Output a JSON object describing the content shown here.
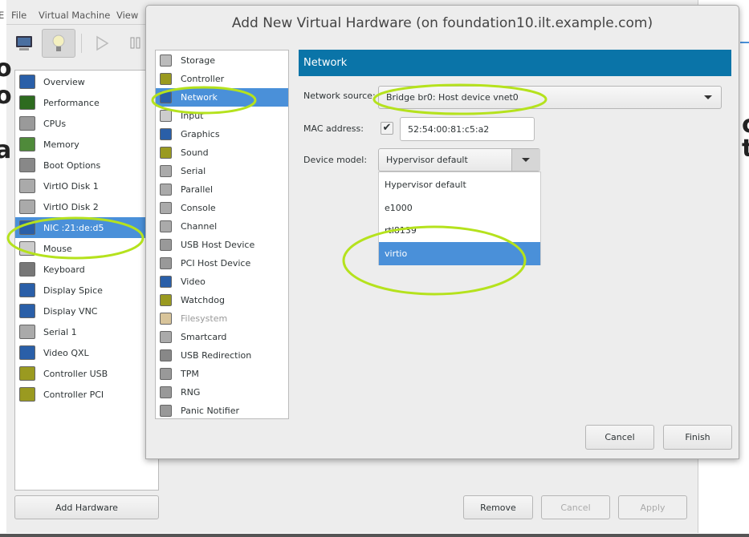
{
  "main_window": {
    "menu": [
      "E",
      "File",
      "Virtual Machine",
      "View"
    ],
    "toolbar": {
      "console": "monitor-icon",
      "details": "lightbulb-icon",
      "run": "play-icon",
      "pause": "pause-icon"
    },
    "hardware_list": [
      {
        "label": "Overview",
        "icon": "monitor-icon",
        "color": "#2a5fa8"
      },
      {
        "label": "Performance",
        "icon": "chart-icon",
        "color": "#2d6b1f"
      },
      {
        "label": "CPUs",
        "icon": "chip-icon",
        "color": "#9a9a9a"
      },
      {
        "label": "Memory",
        "icon": "memory-icon",
        "color": "#4f8a3a"
      },
      {
        "label": "Boot Options",
        "icon": "gears-icon",
        "color": "#888888"
      },
      {
        "label": "VirtIO Disk 1",
        "icon": "disk-icon",
        "color": "#aaaaaa"
      },
      {
        "label": "VirtIO Disk 2",
        "icon": "disk-icon",
        "color": "#aaaaaa"
      },
      {
        "label": "NIC :21:de:d5",
        "icon": "network-icon",
        "color": "#2a5fa8",
        "selected": true
      },
      {
        "label": "Mouse",
        "icon": "mouse-icon",
        "color": "#cccccc"
      },
      {
        "label": "Keyboard",
        "icon": "keyboard-icon",
        "color": "#777777"
      },
      {
        "label": "Display Spice",
        "icon": "monitor-icon",
        "color": "#2a5fa8"
      },
      {
        "label": "Display VNC",
        "icon": "monitor-icon",
        "color": "#2a5fa8"
      },
      {
        "label": "Serial 1",
        "icon": "serial-icon",
        "color": "#aaaaaa"
      },
      {
        "label": "Video QXL",
        "icon": "monitor-icon",
        "color": "#2a5fa8"
      },
      {
        "label": "Controller USB",
        "icon": "card-icon",
        "color": "#9a9a20"
      },
      {
        "label": "Controller PCI",
        "icon": "card-icon",
        "color": "#9a9a20"
      }
    ],
    "add_hardware": "Add Hardware",
    "remove": "Remove",
    "cancel": "Cancel",
    "apply": "Apply",
    "behind_text": {
      "left": [
        "o",
        "o",
        "a"
      ],
      "right": [
        "c",
        "t"
      ]
    }
  },
  "dialog": {
    "title": "Add New Virtual Hardware (on foundation10.ilt.example.com)",
    "hardware_types": [
      {
        "label": "Storage",
        "icon": "disk-icon",
        "color": "#bbbbbb"
      },
      {
        "label": "Controller",
        "icon": "card-icon",
        "color": "#9a9a20"
      },
      {
        "label": "Network",
        "icon": "network-icon",
        "color": "#2a5fa8",
        "selected": true
      },
      {
        "label": "Input",
        "icon": "mouse-icon",
        "color": "#cccccc"
      },
      {
        "label": "Graphics",
        "icon": "monitor-icon",
        "color": "#2a5fa8"
      },
      {
        "label": "Sound",
        "icon": "card-icon",
        "color": "#9a9a20"
      },
      {
        "label": "Serial",
        "icon": "serial-icon",
        "color": "#aaaaaa"
      },
      {
        "label": "Parallel",
        "icon": "serial-icon",
        "color": "#aaaaaa"
      },
      {
        "label": "Console",
        "icon": "serial-icon",
        "color": "#aaaaaa"
      },
      {
        "label": "Channel",
        "icon": "serial-icon",
        "color": "#aaaaaa"
      },
      {
        "label": "USB Host Device",
        "icon": "gears-icon",
        "color": "#999999"
      },
      {
        "label": "PCI Host Device",
        "icon": "gears-icon",
        "color": "#999999"
      },
      {
        "label": "Video",
        "icon": "monitor-icon",
        "color": "#2a5fa8"
      },
      {
        "label": "Watchdog",
        "icon": "card-icon",
        "color": "#9a9a20"
      },
      {
        "label": "Filesystem",
        "icon": "folder-icon",
        "color": "#d8c49a",
        "disabled": true
      },
      {
        "label": "Smartcard",
        "icon": "smartcard-icon",
        "color": "#aaaaaa"
      },
      {
        "label": "USB Redirection",
        "icon": "usb-icon",
        "color": "#888888"
      },
      {
        "label": "TPM",
        "icon": "chip-icon",
        "color": "#999999"
      },
      {
        "label": "RNG",
        "icon": "gears-icon",
        "color": "#999999"
      },
      {
        "label": "Panic Notifier",
        "icon": "gears-icon",
        "color": "#999999"
      }
    ],
    "section_header": "Network",
    "header_color": "#0a74a8",
    "network_source_label": "Network source:",
    "network_source_value": "Bridge br0: Host device vnet0",
    "mac_label": "MAC address:",
    "mac_checked": true,
    "mac_value": "52:54:00:81:c5:a2",
    "device_model_label": "Device model:",
    "device_model_value": "Hypervisor default",
    "device_model_options": [
      {
        "label": "Hypervisor default"
      },
      {
        "label": "e1000"
      },
      {
        "label": "rtl8139"
      },
      {
        "label": "virtio",
        "selected": true
      }
    ],
    "cancel": "Cancel",
    "finish": "Finish"
  },
  "annotation_color": "#b5e21d"
}
